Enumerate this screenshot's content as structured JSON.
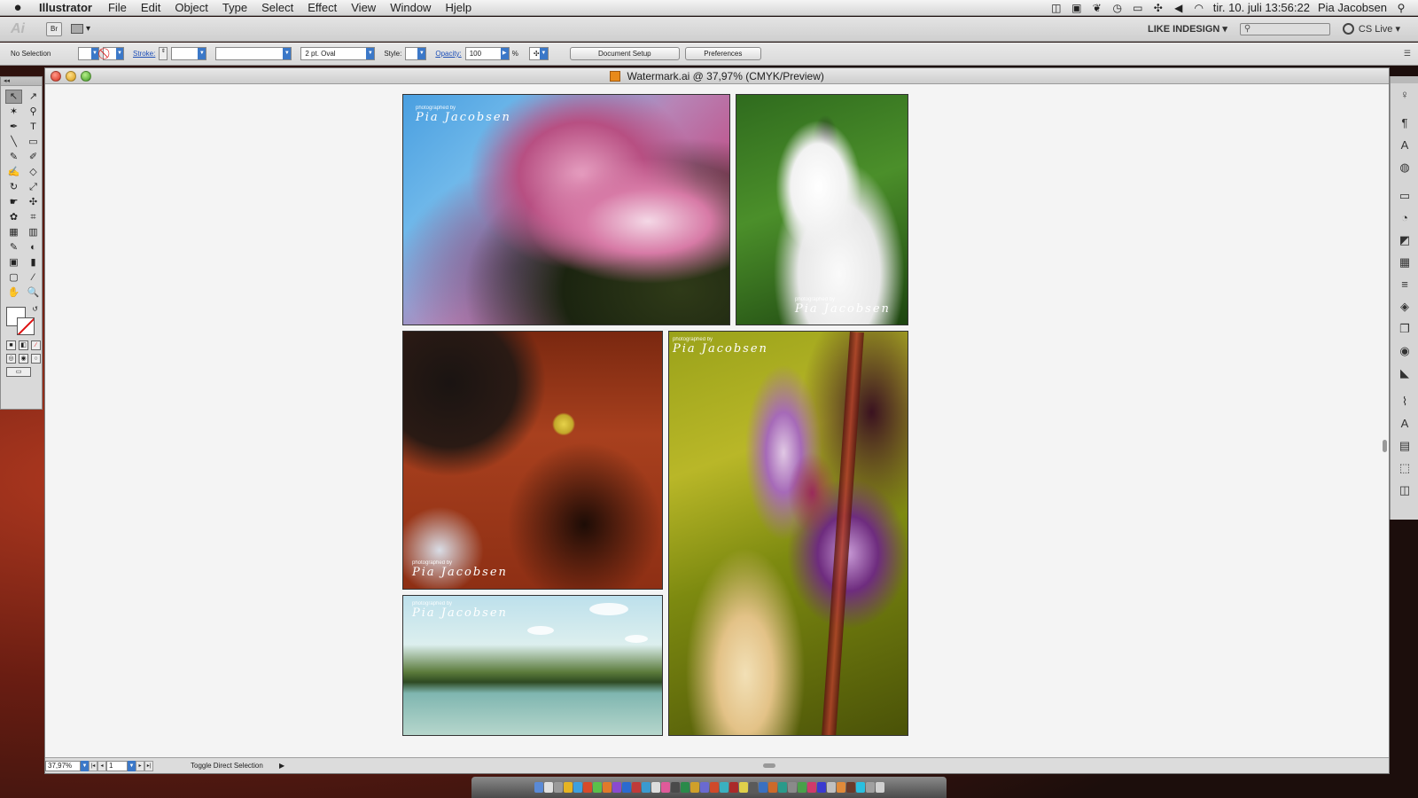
{
  "menubar": {
    "app_name": "Illustrator",
    "menus": [
      "File",
      "Edit",
      "Object",
      "Type",
      "Select",
      "Effect",
      "View",
      "Window",
      "Hjelp"
    ],
    "datetime": "tir. 10. juli  13:56:22",
    "user": "Pia Jacobsen"
  },
  "appbar": {
    "logo": "Ai",
    "bridge": "Br",
    "workspace": "LIKE INDESIGN ▾",
    "cs_live": "CS Live ▾"
  },
  "controlbar": {
    "selection": "No Selection",
    "stroke_label": "Stroke:",
    "brush": "2 pt. Oval",
    "style_label": "Style:",
    "opacity_label": "Opacity:",
    "opacity_value": "100",
    "percent": "%",
    "document_setup": "Document Setup",
    "preferences": "Preferences"
  },
  "document": {
    "title": "Watermark.ai @ 37,97% (CMYK/Preview)"
  },
  "watermark": {
    "small": "photographed by",
    "signature": "Pia Jacobsen"
  },
  "statusbar": {
    "zoom": "37,97%",
    "page": "1",
    "status": "Toggle Direct Selection"
  },
  "tools": [
    "↖",
    "↗",
    "✶",
    "⚲",
    "✒",
    "T",
    "╲",
    "▭",
    "✎",
    "✐",
    "✍",
    "◇",
    "↻",
    "⤢",
    "☛",
    "✣",
    "✿",
    "⌗",
    "▦",
    "▥",
    "✎",
    "◐",
    "▣",
    "▮",
    "▢",
    "⁄",
    "✋",
    "🔍"
  ],
  "colors": {
    "accent_blue": "#3b78c8",
    "link_blue": "#1d4fb8",
    "stroke_none_red": "#d11111"
  }
}
